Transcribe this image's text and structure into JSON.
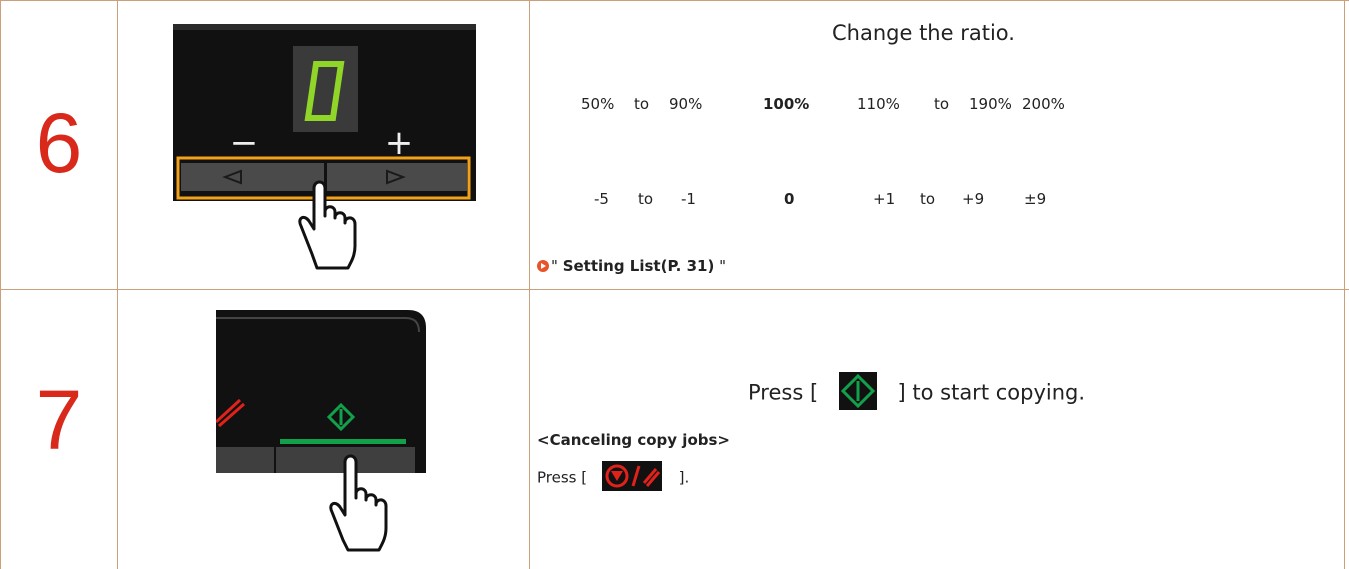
{
  "steps": [
    {
      "number": "6",
      "heading": "Change the ratio.",
      "ratio_row": {
        "range1_from": "50%",
        "to1": "to",
        "range1_to": "90%",
        "center": "100%",
        "range2_from": "110%",
        "to2": "to",
        "range2_to": "190%",
        "max": "200%"
      },
      "display_row": {
        "range1_from": "-5",
        "to1": "to",
        "range1_to": "-1",
        "center": "0",
        "range2_from": "+1",
        "to2": "to",
        "range2_to": "+9",
        "max": "±9"
      },
      "link_quote_open": "\"",
      "link_text": "Setting List(P. 31)",
      "link_quote_close": "\"",
      "panel": {
        "display_digit": "0",
        "minus": "−",
        "plus": "+"
      }
    },
    {
      "number": "7",
      "press_prefix": "Press [",
      "press_suffix": "] to start copying.",
      "cancel_heading": "<Canceling copy jobs>",
      "cancel_prefix": "Press [",
      "cancel_suffix": "]."
    }
  ],
  "colors": {
    "border": "#c9a07a",
    "step_number": "#d8291b",
    "lcd_green": "#8fd629",
    "highlight_box": "#f2a21a",
    "start_green": "#12a04a",
    "stop_red": "#e0221b"
  },
  "icons": [
    "left-triangle-icon",
    "right-triangle-icon",
    "pointing-hand-icon",
    "start-key-icon",
    "stop-reset-key-icon",
    "link-arrow-icon"
  ]
}
